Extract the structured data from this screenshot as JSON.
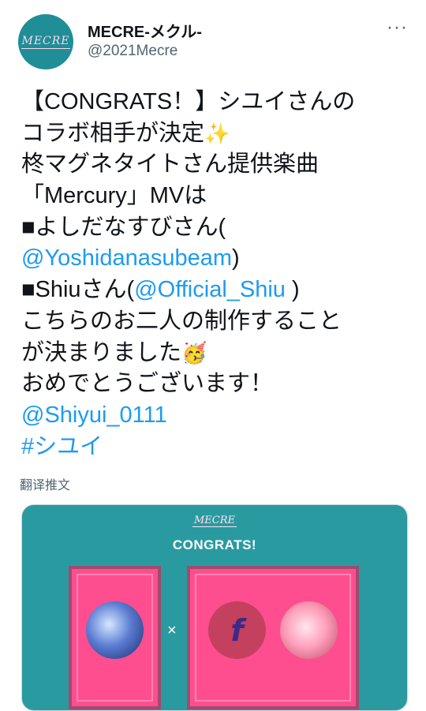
{
  "account": {
    "name": "MECRE-メクル-",
    "handle": "@2021Mecre",
    "avatar_label": "MECRE"
  },
  "more_label": "···",
  "tweet_lines": {
    "l1": "【CONGRATS！】シユイさんの",
    "l2": "コラボ相手が決定",
    "l2_emoji": "✨",
    "l3": "柊マグネタイトさん提供楽曲",
    "l4": "「Mercury」MVは",
    "l5": "■よしだなすびさん(",
    "l6_link": "@Yoshidanasubeam",
    "l6_tail": ")",
    "l7_pre": "■Shiuさん(",
    "l7_link": "@Official_Shiu",
    "l7_tail": " )",
    "l8": "こちらのお二人の制作すること",
    "l9": "が決まりました",
    "l9_emoji": "🥳",
    "l10": "おめでとうございます！",
    "l11_link": "@Shiyui_0111",
    "l12_link": "#シユイ"
  },
  "translate_label": "翻译推文",
  "card": {
    "logo": "MECRE",
    "title": "CONGRATS!",
    "times": "×",
    "logo_mark": "f"
  },
  "colors": {
    "link": "#1d9bf0",
    "card_bg": "#2a9aa1",
    "panel_pink": "#ff4e8f"
  }
}
